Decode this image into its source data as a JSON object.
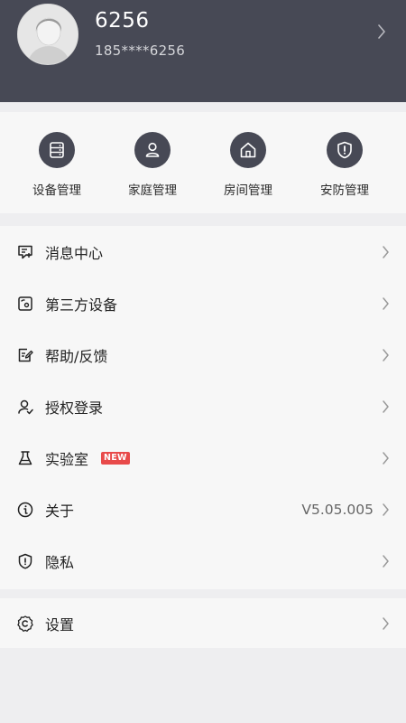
{
  "user": {
    "name": "6256",
    "phone": "185****6256"
  },
  "quick_actions": [
    {
      "label": "设备管理",
      "icon": "device-list-icon"
    },
    {
      "label": "家庭管理",
      "icon": "person-icon"
    },
    {
      "label": "房间管理",
      "icon": "house-icon"
    },
    {
      "label": "安防管理",
      "icon": "shield-alert-icon"
    }
  ],
  "menu": [
    {
      "label": "消息中心",
      "icon": "message-icon"
    },
    {
      "label": "第三方设备",
      "icon": "third-party-device-icon"
    },
    {
      "label": "帮助/反馈",
      "icon": "feedback-icon"
    },
    {
      "label": "授权登录",
      "icon": "authorize-icon"
    },
    {
      "label": "实验室",
      "icon": "flask-icon",
      "badge": "NEW"
    },
    {
      "label": "关于",
      "icon": "info-icon",
      "value": "V5.05.005"
    },
    {
      "label": "隐私",
      "icon": "privacy-shield-icon"
    }
  ],
  "settings": {
    "label": "设置",
    "icon": "settings-gear-icon"
  },
  "colors": {
    "header_bg": "#474955",
    "badge": "#e84a4a",
    "page_bg": "#eeeef0",
    "card_bg": "#f7f7f7"
  }
}
